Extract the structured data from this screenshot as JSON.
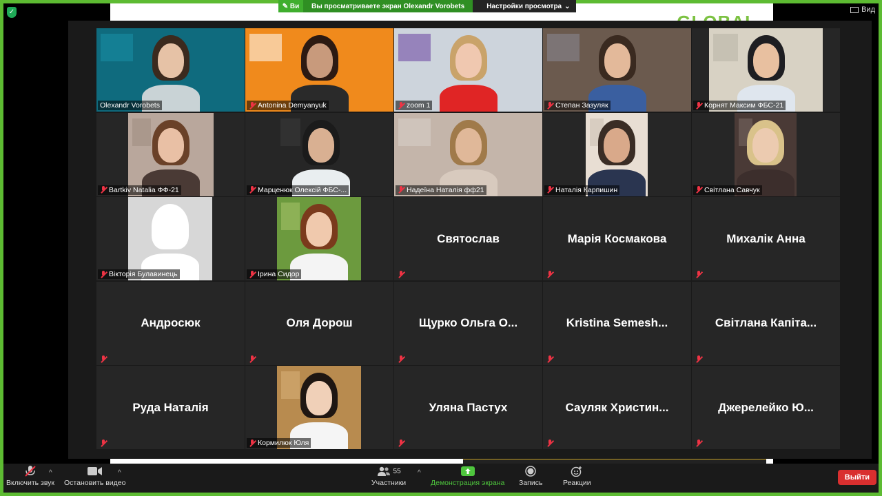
{
  "banner": {
    "left_text": "Ви",
    "message": "Вы просматриваете экран Olexandr Vorobets",
    "options": "Настройки просмотра"
  },
  "view_label": "Вид",
  "shared_logo": "GLOBAL",
  "tiles": [
    {
      "name": "Olexandr Vorobets",
      "type": "video",
      "active": true,
      "muted": false
    },
    {
      "name": "Antonina Demyanyuk",
      "type": "video",
      "muted": true
    },
    {
      "name": "zoom 1",
      "type": "video",
      "muted": true
    },
    {
      "name": "Степан Зазуляк",
      "type": "video",
      "muted": true
    },
    {
      "name": "Корнят Максим ФБС-21",
      "type": "video",
      "muted": true
    },
    {
      "name": "Bartkiv Natalia ФФ-21",
      "type": "video",
      "muted": true
    },
    {
      "name": "Марценюк Олексій ФБС-...",
      "type": "video",
      "muted": true
    },
    {
      "name": "Надеїна Наталія фф21",
      "type": "video",
      "muted": true
    },
    {
      "name": "Наталія Карпишин",
      "type": "video",
      "muted": true
    },
    {
      "name": "Світлана Савчук",
      "type": "video",
      "muted": true
    },
    {
      "name": "Вікторія Булавинець",
      "type": "photo",
      "muted": true
    },
    {
      "name": "Ірина Сидор",
      "type": "photo",
      "muted": true
    },
    {
      "name": "Святослав",
      "type": "name",
      "muted": true
    },
    {
      "name": "Марія Космакова",
      "type": "name",
      "muted": true
    },
    {
      "name": "Михалік Анна",
      "type": "name",
      "muted": true
    },
    {
      "name": "Андросюк",
      "type": "name",
      "muted": true
    },
    {
      "name": "Оля Дорош",
      "type": "name",
      "muted": true
    },
    {
      "name": "Щурко Ольга О...",
      "type": "name",
      "muted": true
    },
    {
      "name": "Kristina Semesh...",
      "type": "name",
      "muted": true
    },
    {
      "name": "Світлана Капіта...",
      "type": "name",
      "muted": true
    },
    {
      "name": "Руда Наталія",
      "type": "name",
      "muted": true
    },
    {
      "name": "Кормилюк Юля",
      "type": "photo",
      "muted": true
    },
    {
      "name": "Уляна Пастух",
      "type": "name",
      "muted": true
    },
    {
      "name": "Сауляк Христин...",
      "type": "name",
      "muted": true
    },
    {
      "name": "Джерелейко Ю...",
      "type": "name",
      "muted": true
    }
  ],
  "toolbar": {
    "unmute": "Включить звук",
    "stop_video": "Остановить видео",
    "participants": "Участники",
    "participants_count": "55",
    "share_screen": "Демонстрация экрана",
    "record": "Запись",
    "reactions": "Реакции",
    "leave": "Выйти"
  }
}
